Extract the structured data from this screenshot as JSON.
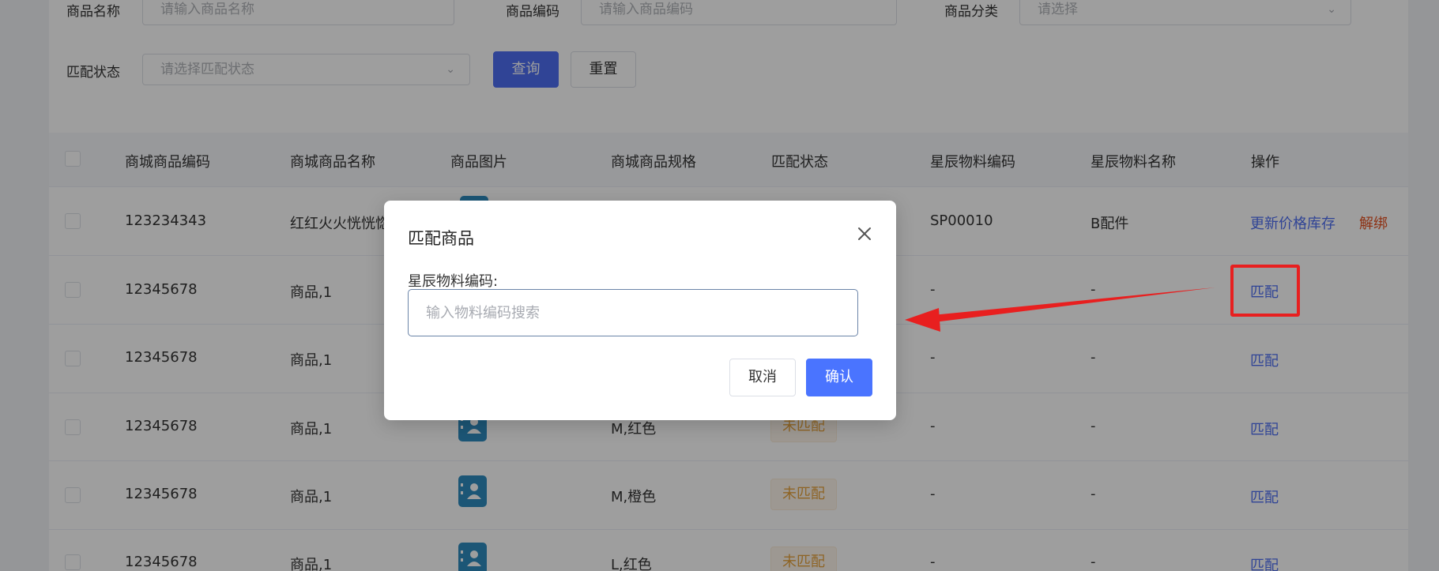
{
  "filters": {
    "product_name_label": "商品名称",
    "product_name_placeholder": "请输入商品名称",
    "product_code_label": "商品编码",
    "product_code_placeholder": "请输入商品编码",
    "category_label": "商品分类",
    "category_placeholder": "请选择",
    "match_status_label": "匹配状态",
    "match_status_placeholder": "请选择匹配状态",
    "query_button": "查询",
    "reset_button": "重置"
  },
  "table": {
    "columns": [
      "商城商品编码",
      "商城商品名称",
      "商品图片",
      "商城商品规格",
      "匹配状态",
      "星辰物料编码",
      "星辰物料名称",
      "操作"
    ],
    "rows": [
      {
        "code": "123234343",
        "name": "红红火火恍恍惚",
        "spec": "",
        "status": "",
        "material_code": "SP00010",
        "material_name": "B配件",
        "actions": [
          "更新价格库存",
          "解绑"
        ]
      },
      {
        "code": "12345678",
        "name": "商品,1",
        "spec": "",
        "status": "",
        "material_code": "-",
        "material_name": "-",
        "actions": [
          "匹配"
        ]
      },
      {
        "code": "12345678",
        "name": "商品,1",
        "spec": "",
        "status": "",
        "material_code": "-",
        "material_name": "-",
        "actions": [
          "匹配"
        ]
      },
      {
        "code": "12345678",
        "name": "商品,1",
        "spec": "M,红色",
        "status": "未匹配",
        "material_code": "-",
        "material_name": "-",
        "actions": [
          "匹配"
        ]
      },
      {
        "code": "12345678",
        "name": "商品,1",
        "spec": "M,橙色",
        "status": "未匹配",
        "material_code": "-",
        "material_name": "-",
        "actions": [
          "匹配"
        ]
      },
      {
        "code": "12345678",
        "name": "商品,1",
        "spec": "L,红色",
        "status": "未匹配",
        "material_code": "-",
        "material_name": "-",
        "actions": [
          "匹配"
        ]
      }
    ]
  },
  "dialog": {
    "title": "匹配商品",
    "field_label": "星辰物料编码:",
    "field_placeholder": "输入物料编码搜索",
    "field_value": "",
    "cancel_button": "取消",
    "confirm_button": "确认"
  },
  "colors": {
    "primary": "#4e6ef2",
    "danger": "#e6501f",
    "warning": "#e6a23c",
    "annotation": "#e81f1f"
  },
  "icons": {
    "close": "close-icon",
    "chevron": "chevron-down-icon",
    "product_image": "contact-card-icon"
  }
}
